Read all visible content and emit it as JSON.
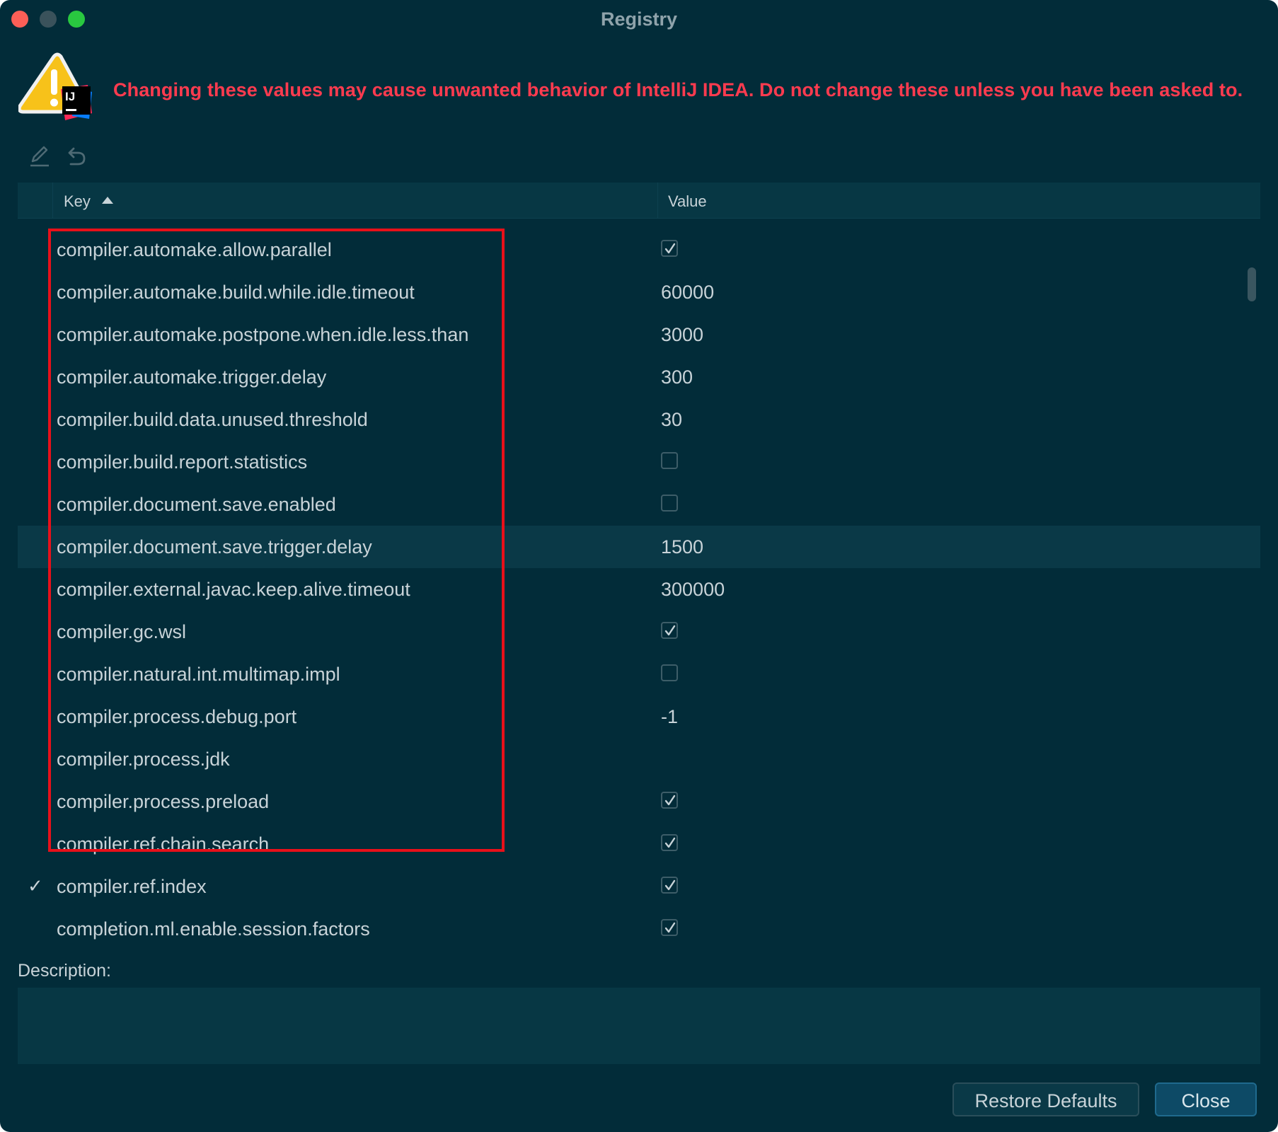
{
  "window": {
    "title": "Registry"
  },
  "warning": {
    "text": "Changing these values may cause unwanted behavior of IntelliJ IDEA. Do not change these unless you have been asked to.",
    "color": "#ff3b4f",
    "icon": "warning-intellij-icon",
    "icon_badge": "IJ"
  },
  "toolbar": {
    "edit_icon": "pencil-icon",
    "revert_icon": "undo-icon"
  },
  "table": {
    "columns": [
      "Key",
      "Value"
    ],
    "sort": {
      "column": "Key",
      "direction": "ascending"
    },
    "rows": [
      {
        "mark": "",
        "key": "compiler.automake.allow.parallel",
        "type": "checkbox",
        "checked": true,
        "value": ""
      },
      {
        "mark": "",
        "key": "compiler.automake.build.while.idle.timeout",
        "type": "text",
        "checked": false,
        "value": "60000"
      },
      {
        "mark": "",
        "key": "compiler.automake.postpone.when.idle.less.than",
        "type": "text",
        "checked": false,
        "value": "3000"
      },
      {
        "mark": "",
        "key": "compiler.automake.trigger.delay",
        "type": "text",
        "checked": false,
        "value": "300"
      },
      {
        "mark": "",
        "key": "compiler.build.data.unused.threshold",
        "type": "text",
        "checked": false,
        "value": "30"
      },
      {
        "mark": "",
        "key": "compiler.build.report.statistics",
        "type": "checkbox",
        "checked": false,
        "value": ""
      },
      {
        "mark": "",
        "key": "compiler.document.save.enabled",
        "type": "checkbox",
        "checked": false,
        "value": ""
      },
      {
        "mark": "",
        "key": "compiler.document.save.trigger.delay",
        "type": "text",
        "checked": false,
        "value": "1500",
        "selected": true
      },
      {
        "mark": "",
        "key": "compiler.external.javac.keep.alive.timeout",
        "type": "text",
        "checked": false,
        "value": "300000"
      },
      {
        "mark": "",
        "key": "compiler.gc.wsl",
        "type": "checkbox",
        "checked": true,
        "value": ""
      },
      {
        "mark": "",
        "key": "compiler.natural.int.multimap.impl",
        "type": "checkbox",
        "checked": false,
        "value": ""
      },
      {
        "mark": "",
        "key": "compiler.process.debug.port",
        "type": "text",
        "checked": false,
        "value": "-1"
      },
      {
        "mark": "",
        "key": "compiler.process.jdk",
        "type": "text",
        "checked": false,
        "value": ""
      },
      {
        "mark": "",
        "key": "compiler.process.preload",
        "type": "checkbox",
        "checked": true,
        "value": ""
      },
      {
        "mark": "",
        "key": "compiler.ref.chain.search",
        "type": "checkbox",
        "checked": true,
        "value": ""
      },
      {
        "mark": "✓",
        "key": "compiler.ref.index",
        "type": "checkbox",
        "checked": true,
        "value": ""
      },
      {
        "mark": "",
        "key": "completion.ml.enable.session.factors",
        "type": "checkbox",
        "checked": true,
        "value": ""
      }
    ]
  },
  "annotation": {
    "highlight_color": "#e8101a"
  },
  "description": {
    "label": "Description:",
    "value": ""
  },
  "buttons": {
    "restore_label": "Restore Defaults",
    "close_label": "Close"
  }
}
